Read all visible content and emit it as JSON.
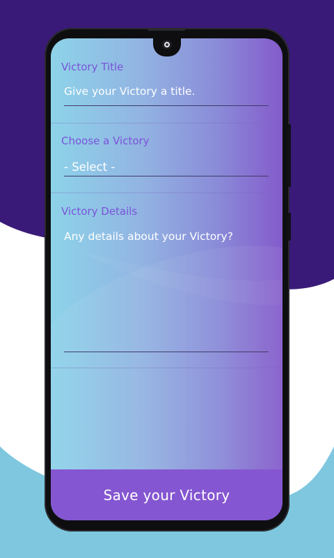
{
  "form": {
    "title_label": "Victory Title",
    "title_placeholder": "Give your Victory a title.",
    "choose_label": "Choose a Victory",
    "choose_selected": "- Select -",
    "details_label": "Victory Details",
    "details_placeholder": "Any details about your Victory?",
    "save_label": "Save your Victory"
  },
  "colors": {
    "background_purple": "#3a1a78",
    "background_blue": "#7ec7df",
    "label_purple": "#7a54d8",
    "button_purple": "#8556d1"
  }
}
